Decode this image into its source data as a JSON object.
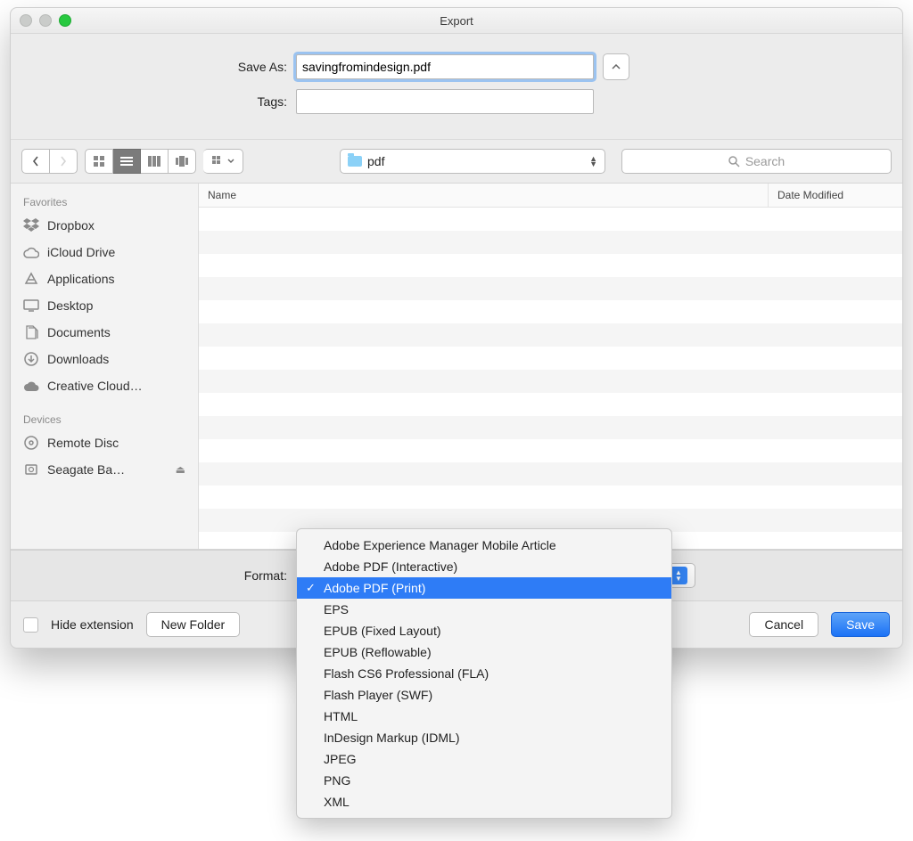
{
  "title": "Export",
  "form": {
    "save_as_label": "Save As:",
    "save_as_value": "savingfromindesign.pdf",
    "tags_label": "Tags:",
    "tags_value": ""
  },
  "location": {
    "folder_name": "pdf"
  },
  "search": {
    "placeholder": "Search"
  },
  "columns": {
    "name": "Name",
    "date": "Date Modified"
  },
  "sidebar": {
    "favorites_header": "Favorites",
    "devices_header": "Devices",
    "favorites": [
      {
        "label": "Dropbox"
      },
      {
        "label": "iCloud Drive"
      },
      {
        "label": "Applications"
      },
      {
        "label": "Desktop"
      },
      {
        "label": "Documents"
      },
      {
        "label": "Downloads"
      },
      {
        "label": "Creative Cloud…"
      }
    ],
    "devices": [
      {
        "label": "Remote Disc"
      },
      {
        "label": "Seagate Ba…",
        "eject": true
      }
    ]
  },
  "format": {
    "label": "Format:",
    "selected": "Adobe PDF (Print)",
    "options": [
      "Adobe Experience Manager Mobile Article",
      "Adobe PDF (Interactive)",
      "Adobe PDF (Print)",
      "EPS",
      "EPUB (Fixed Layout)",
      "EPUB (Reflowable)",
      "Flash CS6 Professional (FLA)",
      "Flash Player (SWF)",
      "HTML",
      "InDesign Markup (IDML)",
      "JPEG",
      "PNG",
      "XML"
    ]
  },
  "bottom": {
    "hide_extension": "Hide extension",
    "new_folder": "New Folder",
    "cancel": "Cancel",
    "save": "Save"
  }
}
